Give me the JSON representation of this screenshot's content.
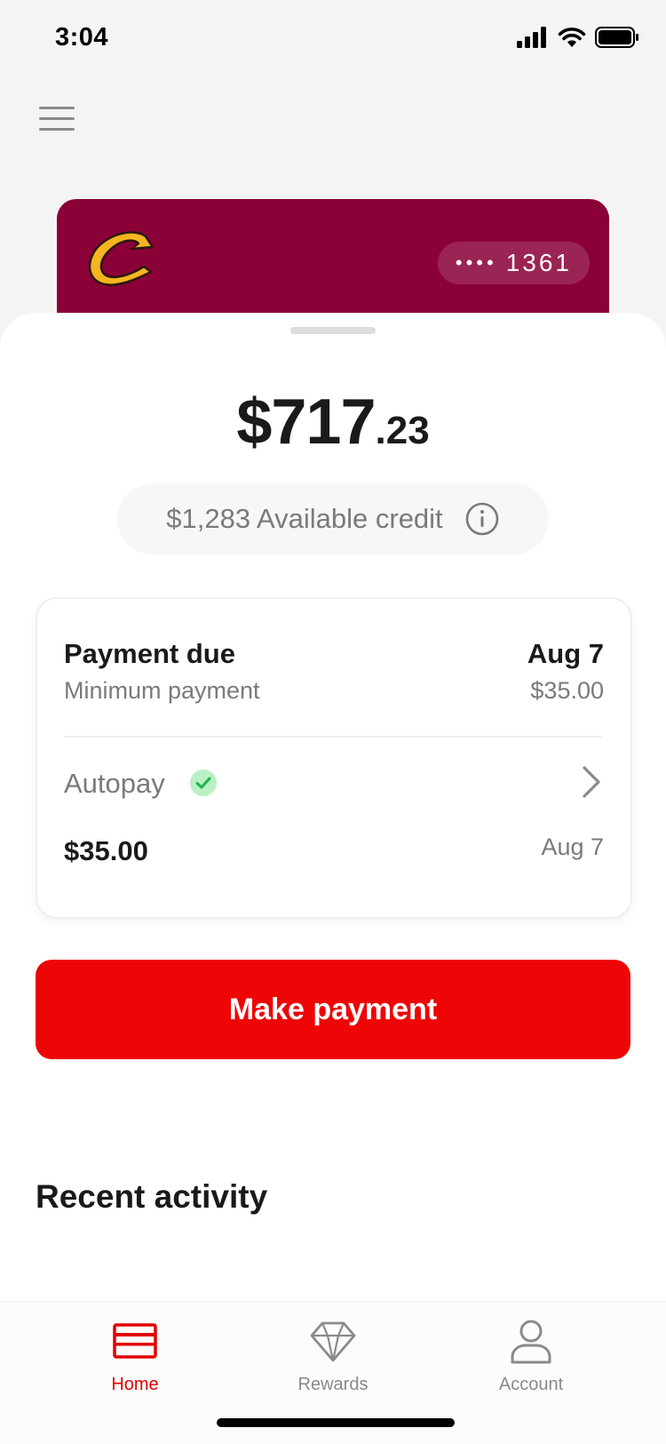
{
  "status_bar": {
    "time": "3:04"
  },
  "card": {
    "mask": "••••",
    "last_four": "1361",
    "logo_icon": "c-letter-logo-icon",
    "color": "#8a0037"
  },
  "balance": {
    "dollars": "$717",
    "cents": ".23"
  },
  "credit": {
    "text": "$1,283 Available credit",
    "icon": "info-icon"
  },
  "payment": {
    "due_label": "Payment due",
    "due_date": "Aug 7",
    "min_label": "Minimum payment",
    "min_amount": "$35.00",
    "autopay_label": "Autopay",
    "autopay_status": "enabled",
    "autopay_amount": "$35.00",
    "autopay_date": "Aug 7"
  },
  "actions": {
    "make_payment_label": "Make payment",
    "accent_color": "#ee0505"
  },
  "recent": {
    "title": "Recent activity"
  },
  "tabbar": {
    "tabs": [
      {
        "label": "Home",
        "icon": "card-icon",
        "active": true
      },
      {
        "label": "Rewards",
        "icon": "diamond-icon",
        "active": false
      },
      {
        "label": "Account",
        "icon": "person-icon",
        "active": false
      }
    ]
  }
}
